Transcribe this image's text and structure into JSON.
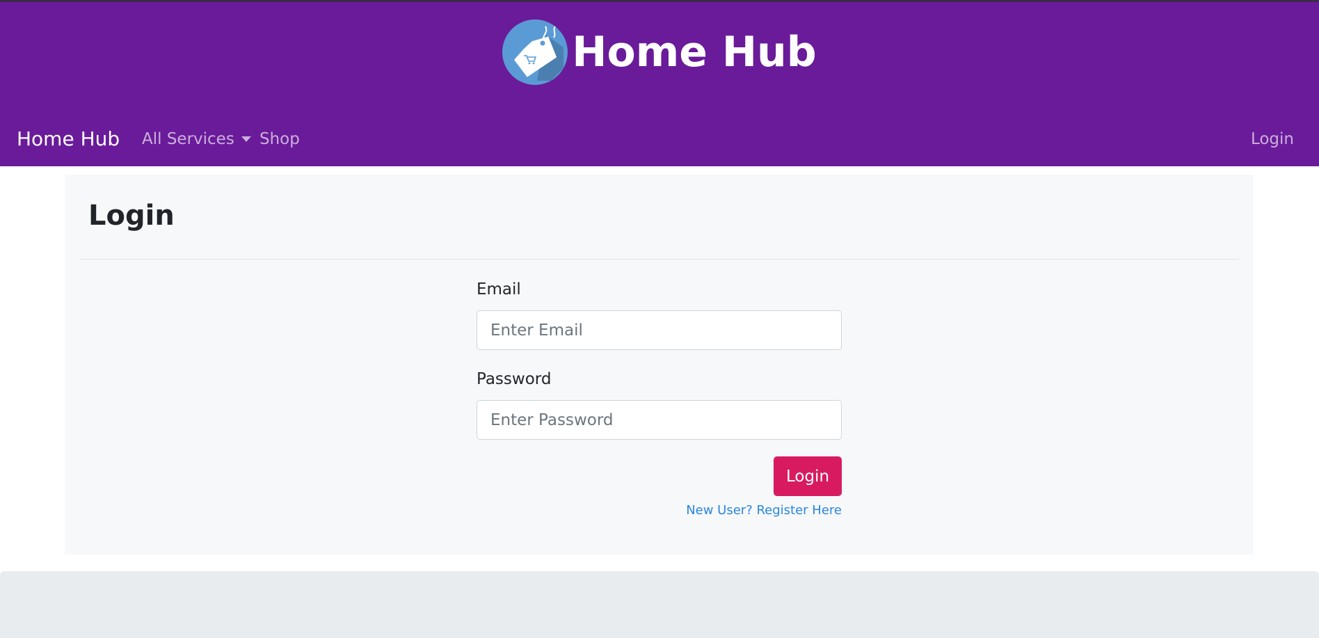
{
  "header": {
    "banner_title": "Home Hub",
    "logo_icon": "shopping-tag-logo",
    "background_color": "#6a1b9a"
  },
  "navbar": {
    "brand": "Home Hub",
    "links": [
      {
        "label": "All Services",
        "dropdown": true
      },
      {
        "label": "Shop"
      }
    ],
    "right_link": "Login"
  },
  "login_card": {
    "title": "Login",
    "email": {
      "label": "Email",
      "placeholder": "Enter Email",
      "value": ""
    },
    "password": {
      "label": "Password",
      "placeholder": "Enter Password",
      "value": ""
    },
    "submit_label": "Login",
    "submit_color": "#d81b60",
    "register_link": "New User? Register Here",
    "link_color": "#2a86e0"
  }
}
